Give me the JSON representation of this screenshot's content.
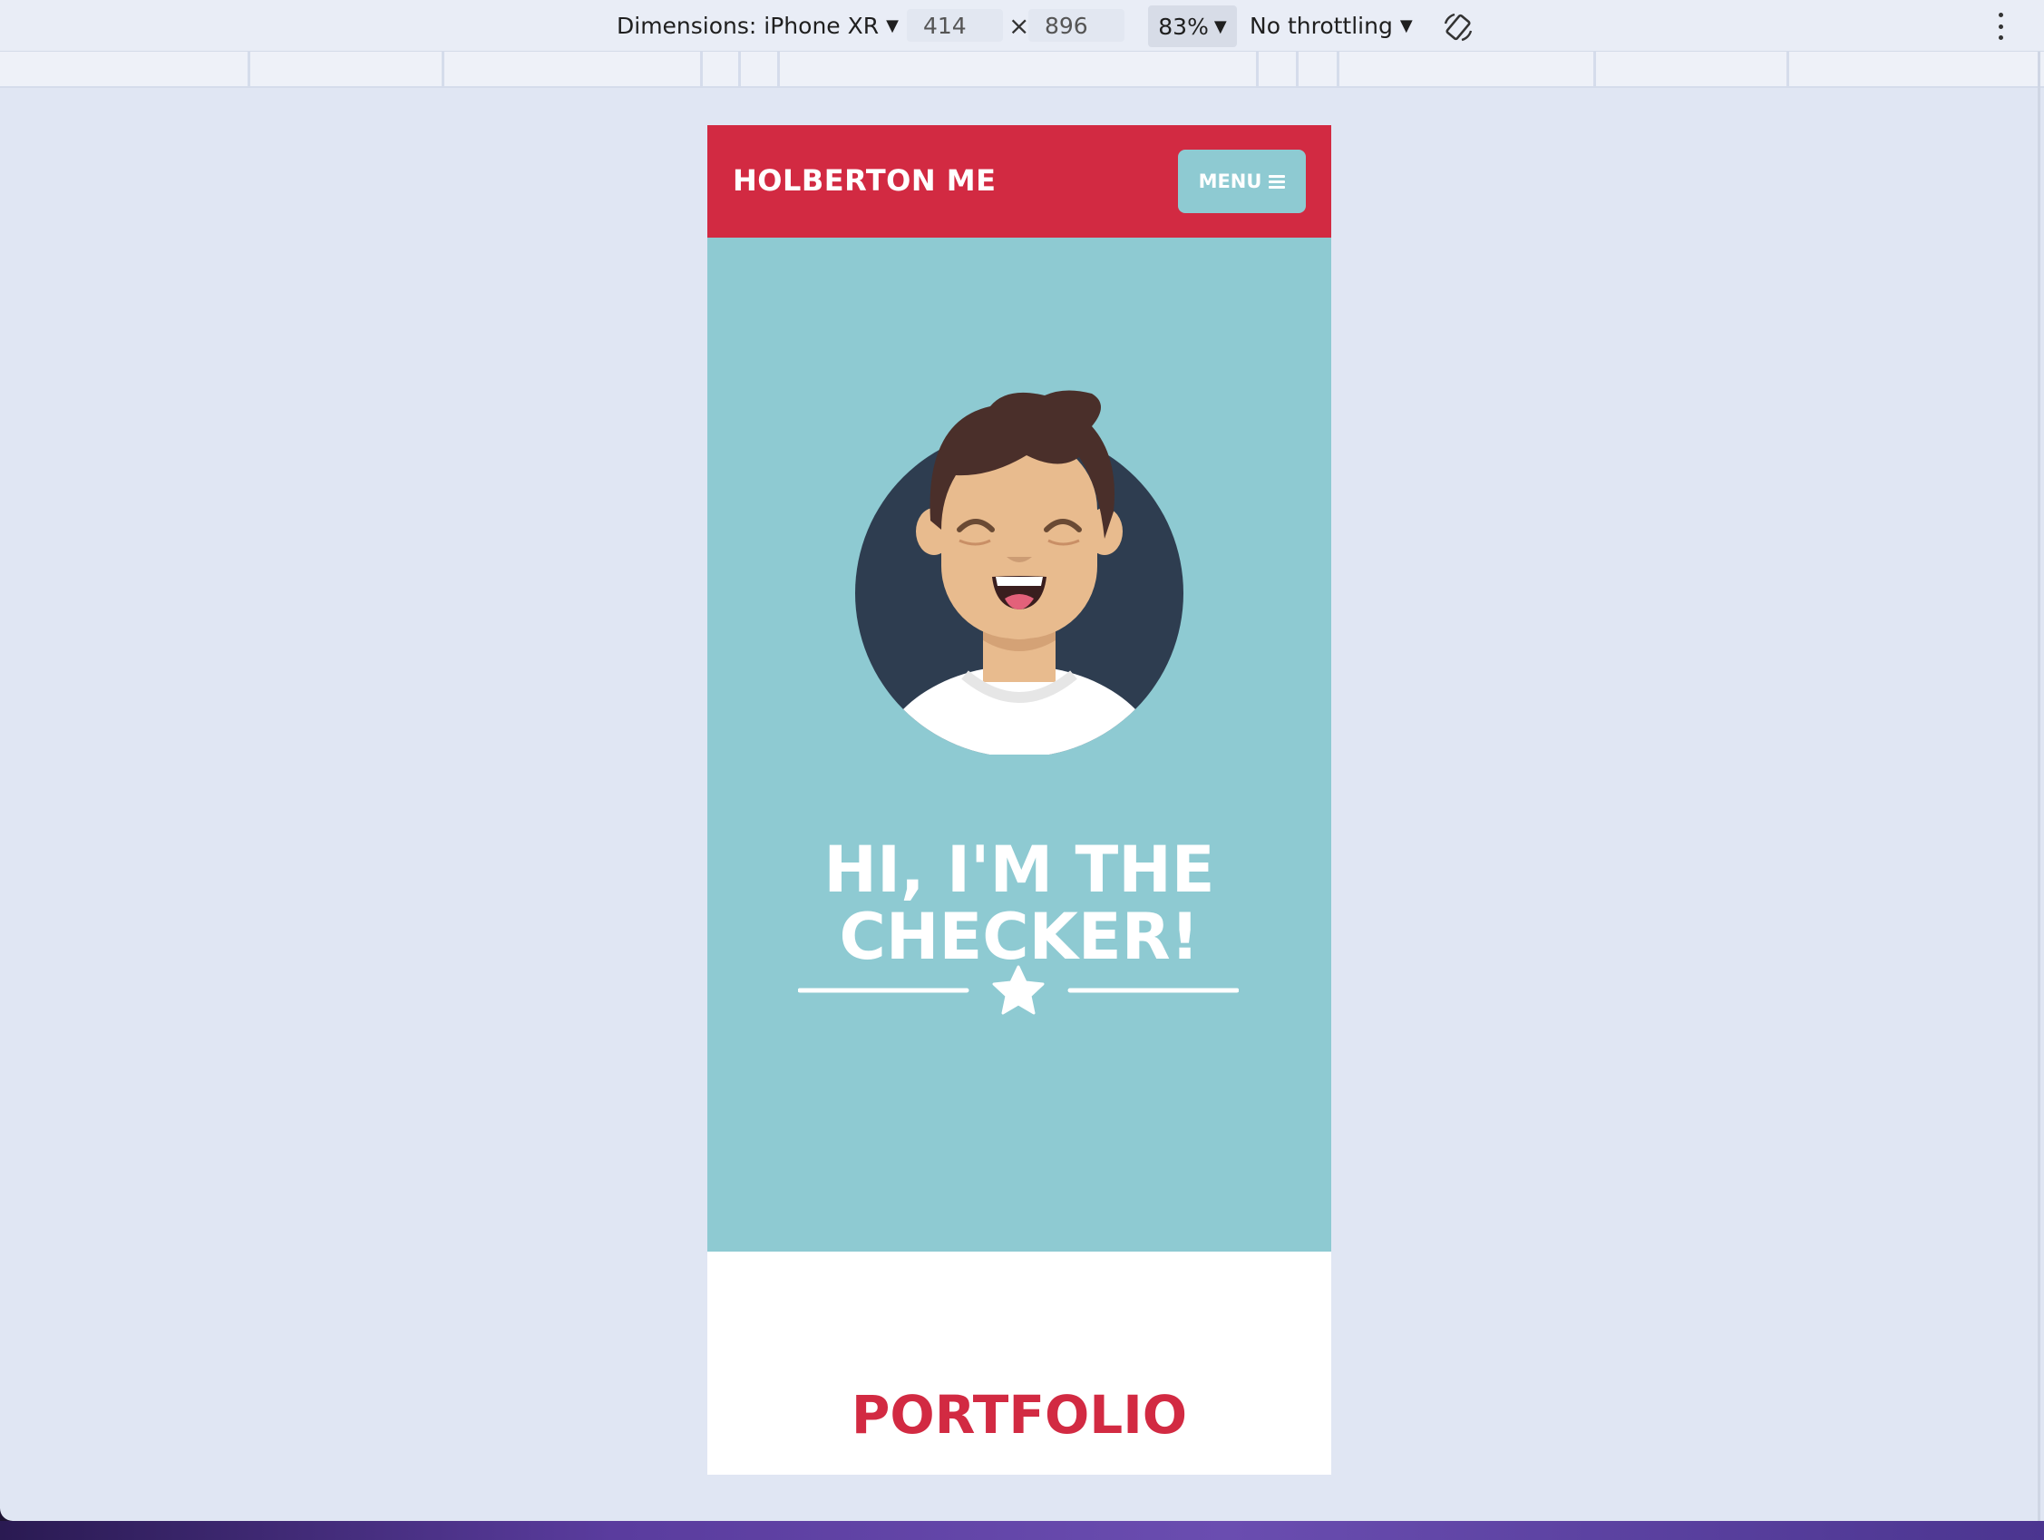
{
  "devtools": {
    "dimensions_label": "Dimensions: iPhone XR",
    "width_value": "414",
    "height_value": "896",
    "times_symbol": "×",
    "zoom_label": "83%",
    "throttling_label": "No throttling",
    "caret": "▼"
  },
  "site": {
    "brand": "HOLBERTON ME",
    "menu_label": "MENU",
    "hero_title_line1": "HI, I'M THE",
    "hero_title_line2": "CHECKER!",
    "portfolio_heading": "PORTFOLIO"
  },
  "colors": {
    "header_red": "#d22a42",
    "hero_teal": "#8ecad2",
    "avatar_circle": "#2e3d50",
    "skin": "#e8bb8e",
    "hair": "#4a2f2a",
    "shirt": "#ffffff"
  },
  "icons": [
    "dropdown-caret-icon",
    "rotate-device-icon",
    "more-options-icon",
    "hamburger-icon",
    "star-icon"
  ]
}
